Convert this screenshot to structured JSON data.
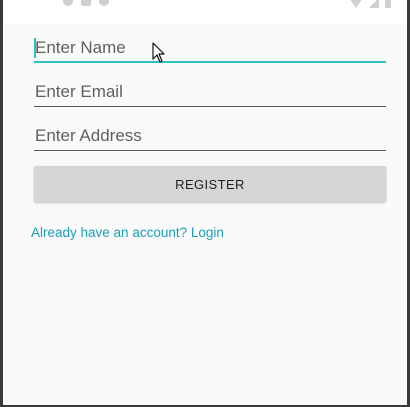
{
  "form": {
    "name_placeholder": "Enter Name",
    "email_placeholder": "Enter Email",
    "address_placeholder": "Enter Address",
    "register_label": "REGISTER",
    "login_link": "Already have an account? Login"
  },
  "colors": {
    "accent": "#26c6c6",
    "link": "#1ca0b8",
    "button_bg": "#d6d6d6",
    "background": "#fafafa"
  },
  "icons": {
    "status_left": [
      "notification-icon",
      "settings-icon",
      "sync-icon"
    ],
    "status_right": [
      "wifi-icon",
      "signal-icon",
      "battery-icon"
    ],
    "pointer": "mouse-pointer-icon"
  }
}
